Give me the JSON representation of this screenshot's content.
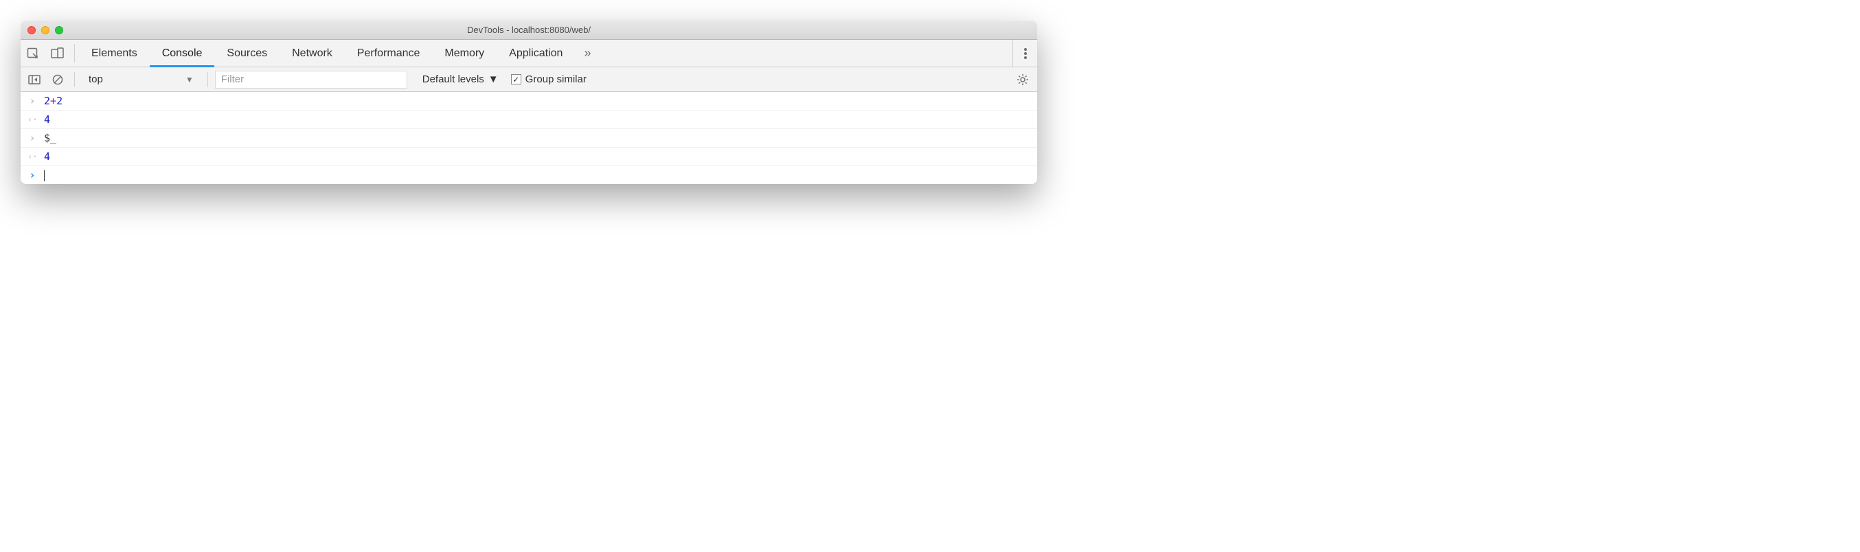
{
  "window": {
    "title": "DevTools - localhost:8080/web/"
  },
  "tabs": {
    "items": [
      {
        "label": "Elements"
      },
      {
        "label": "Console",
        "active": true
      },
      {
        "label": "Sources"
      },
      {
        "label": "Network"
      },
      {
        "label": "Performance"
      },
      {
        "label": "Memory"
      },
      {
        "label": "Application"
      }
    ],
    "overflow_icon": "»"
  },
  "toolbar": {
    "context": "top",
    "filter_placeholder": "Filter",
    "levels_label": "Default levels",
    "group_similar_label": "Group similar",
    "group_similar_checked": true
  },
  "console": {
    "entries": [
      {
        "kind": "input",
        "tokens": [
          {
            "t": "num",
            "v": "2"
          },
          {
            "t": "op",
            "v": "+"
          },
          {
            "t": "num",
            "v": "2"
          }
        ]
      },
      {
        "kind": "output",
        "tokens": [
          {
            "t": "num",
            "v": "4"
          }
        ]
      },
      {
        "kind": "input",
        "tokens": [
          {
            "t": "var",
            "v": "$_"
          }
        ]
      },
      {
        "kind": "output",
        "tokens": [
          {
            "t": "num",
            "v": "4"
          }
        ]
      }
    ],
    "prompt_active": true
  }
}
